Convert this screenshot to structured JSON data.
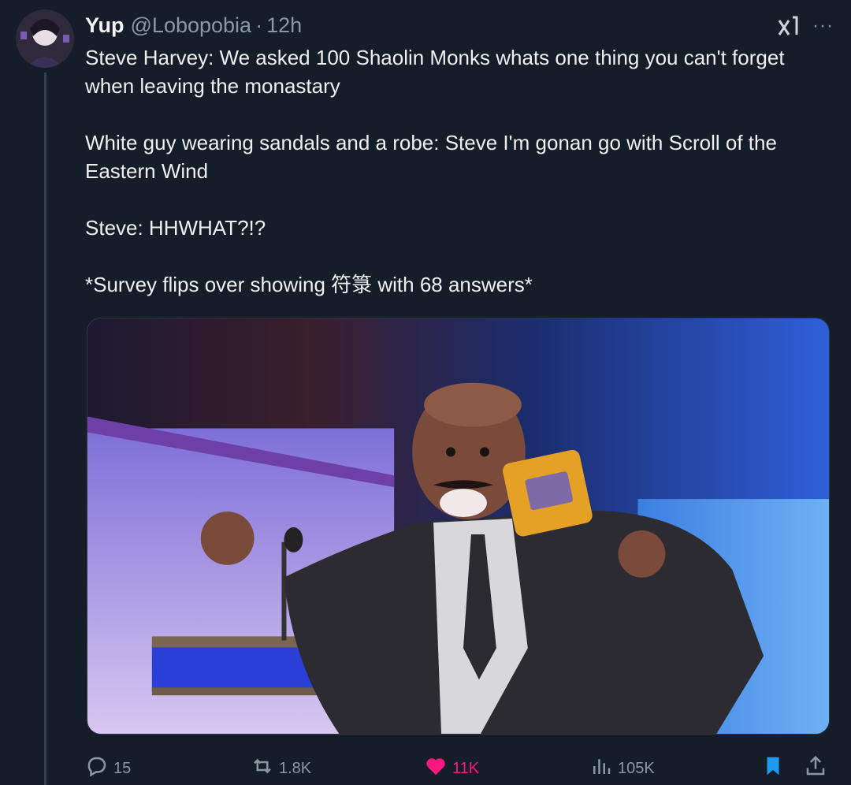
{
  "author": {
    "display_name": "Yup",
    "handle": "@Lobopobia",
    "separator": "·",
    "time": "12h"
  },
  "tweet": {
    "lines": [
      "Steve Harvey: We asked 100 Shaolin Monks whats one thing you can't forget when leaving the monastary",
      "White guy wearing sandals and a robe: Steve I'm gonan go with Scroll of the Eastern Wind",
      "Steve: HHWHAT?!?",
      "*Survey flips over showing 符箓 with 68 answers*"
    ]
  },
  "media": {
    "description_icon": "image"
  },
  "actions": {
    "replies": "15",
    "reposts": "1.8K",
    "likes": "11K",
    "views": "105K"
  },
  "colors": {
    "background": "#151d28",
    "like": "#f91880",
    "bookmark": "#1d9bf0",
    "muted": "#8b98a5"
  }
}
